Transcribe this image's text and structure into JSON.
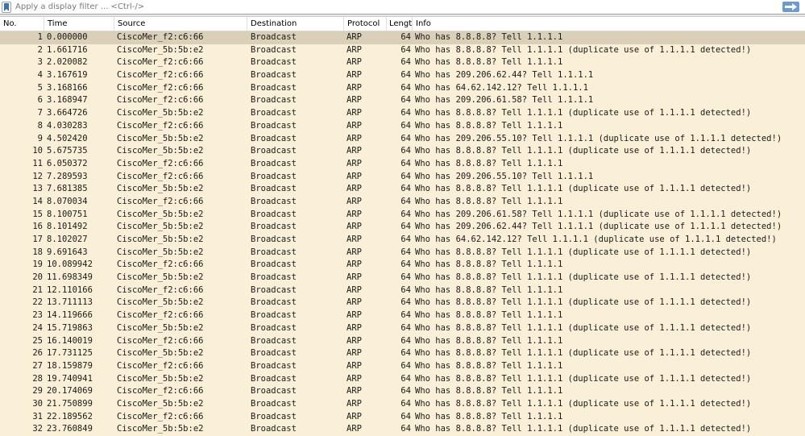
{
  "filter": {
    "placeholder": "Apply a display filter ... <Ctrl-/>",
    "value": "",
    "bookmark_icon": "bookmark-icon",
    "apply_icon": "arrow-right-icon",
    "apply_color": "#6c9bd1"
  },
  "columns": [
    "No.",
    "Time",
    "Source",
    "Destination",
    "Protocol",
    "Length",
    "Info"
  ],
  "colors": {
    "row_bg": "#faf0d7",
    "selected_bg": "#d9d0b7"
  },
  "selected_row": 1,
  "packets": [
    {
      "no": "1",
      "time": "0.000000",
      "source": "CiscoMer_f2:c6:66",
      "destination": "Broadcast",
      "protocol": "ARP",
      "length": "64",
      "info": "Who has 8.8.8.8? Tell 1.1.1.1"
    },
    {
      "no": "2",
      "time": "1.661716",
      "source": "CiscoMer_5b:5b:e2",
      "destination": "Broadcast",
      "protocol": "ARP",
      "length": "64",
      "info": "Who has 8.8.8.8? Tell 1.1.1.1 (duplicate use of 1.1.1.1 detected!)"
    },
    {
      "no": "3",
      "time": "2.020082",
      "source": "CiscoMer_f2:c6:66",
      "destination": "Broadcast",
      "protocol": "ARP",
      "length": "64",
      "info": "Who has 8.8.8.8? Tell 1.1.1.1"
    },
    {
      "no": "4",
      "time": "3.167619",
      "source": "CiscoMer_f2:c6:66",
      "destination": "Broadcast",
      "protocol": "ARP",
      "length": "64",
      "info": "Who has 209.206.62.44? Tell 1.1.1.1"
    },
    {
      "no": "5",
      "time": "3.168166",
      "source": "CiscoMer_f2:c6:66",
      "destination": "Broadcast",
      "protocol": "ARP",
      "length": "64",
      "info": "Who has 64.62.142.12? Tell 1.1.1.1"
    },
    {
      "no": "6",
      "time": "3.168947",
      "source": "CiscoMer_f2:c6:66",
      "destination": "Broadcast",
      "protocol": "ARP",
      "length": "64",
      "info": "Who has 209.206.61.58? Tell 1.1.1.1"
    },
    {
      "no": "7",
      "time": "3.664726",
      "source": "CiscoMer_5b:5b:e2",
      "destination": "Broadcast",
      "protocol": "ARP",
      "length": "64",
      "info": "Who has 8.8.8.8? Tell 1.1.1.1 (duplicate use of 1.1.1.1 detected!)"
    },
    {
      "no": "8",
      "time": "4.030283",
      "source": "CiscoMer_f2:c6:66",
      "destination": "Broadcast",
      "protocol": "ARP",
      "length": "64",
      "info": "Who has 8.8.8.8? Tell 1.1.1.1"
    },
    {
      "no": "9",
      "time": "4.502420",
      "source": "CiscoMer_5b:5b:e2",
      "destination": "Broadcast",
      "protocol": "ARP",
      "length": "64",
      "info": "Who has 209.206.55.10? Tell 1.1.1.1 (duplicate use of 1.1.1.1 detected!)"
    },
    {
      "no": "10",
      "time": "5.675735",
      "source": "CiscoMer_5b:5b:e2",
      "destination": "Broadcast",
      "protocol": "ARP",
      "length": "64",
      "info": "Who has 8.8.8.8? Tell 1.1.1.1 (duplicate use of 1.1.1.1 detected!)"
    },
    {
      "no": "11",
      "time": "6.050372",
      "source": "CiscoMer_f2:c6:66",
      "destination": "Broadcast",
      "protocol": "ARP",
      "length": "64",
      "info": "Who has 8.8.8.8? Tell 1.1.1.1"
    },
    {
      "no": "12",
      "time": "7.289593",
      "source": "CiscoMer_f2:c6:66",
      "destination": "Broadcast",
      "protocol": "ARP",
      "length": "64",
      "info": "Who has 209.206.55.10? Tell 1.1.1.1"
    },
    {
      "no": "13",
      "time": "7.681385",
      "source": "CiscoMer_5b:5b:e2",
      "destination": "Broadcast",
      "protocol": "ARP",
      "length": "64",
      "info": "Who has 8.8.8.8? Tell 1.1.1.1 (duplicate use of 1.1.1.1 detected!)"
    },
    {
      "no": "14",
      "time": "8.070034",
      "source": "CiscoMer_f2:c6:66",
      "destination": "Broadcast",
      "protocol": "ARP",
      "length": "64",
      "info": "Who has 8.8.8.8? Tell 1.1.1.1"
    },
    {
      "no": "15",
      "time": "8.100751",
      "source": "CiscoMer_5b:5b:e2",
      "destination": "Broadcast",
      "protocol": "ARP",
      "length": "64",
      "info": "Who has 209.206.61.58? Tell 1.1.1.1 (duplicate use of 1.1.1.1 detected!)"
    },
    {
      "no": "16",
      "time": "8.101492",
      "source": "CiscoMer_5b:5b:e2",
      "destination": "Broadcast",
      "protocol": "ARP",
      "length": "64",
      "info": "Who has 209.206.62.44? Tell 1.1.1.1 (duplicate use of 1.1.1.1 detected!)"
    },
    {
      "no": "17",
      "time": "8.102027",
      "source": "CiscoMer_5b:5b:e2",
      "destination": "Broadcast",
      "protocol": "ARP",
      "length": "64",
      "info": "Who has 64.62.142.12? Tell 1.1.1.1 (duplicate use of 1.1.1.1 detected!)"
    },
    {
      "no": "18",
      "time": "9.691643",
      "source": "CiscoMer_5b:5b:e2",
      "destination": "Broadcast",
      "protocol": "ARP",
      "length": "64",
      "info": "Who has 8.8.8.8? Tell 1.1.1.1 (duplicate use of 1.1.1.1 detected!)"
    },
    {
      "no": "19",
      "time": "10.089942",
      "source": "CiscoMer_f2:c6:66",
      "destination": "Broadcast",
      "protocol": "ARP",
      "length": "64",
      "info": "Who has 8.8.8.8? Tell 1.1.1.1"
    },
    {
      "no": "20",
      "time": "11.698349",
      "source": "CiscoMer_5b:5b:e2",
      "destination": "Broadcast",
      "protocol": "ARP",
      "length": "64",
      "info": "Who has 8.8.8.8? Tell 1.1.1.1 (duplicate use of 1.1.1.1 detected!)"
    },
    {
      "no": "21",
      "time": "12.110166",
      "source": "CiscoMer_f2:c6:66",
      "destination": "Broadcast",
      "protocol": "ARP",
      "length": "64",
      "info": "Who has 8.8.8.8? Tell 1.1.1.1"
    },
    {
      "no": "22",
      "time": "13.711113",
      "source": "CiscoMer_5b:5b:e2",
      "destination": "Broadcast",
      "protocol": "ARP",
      "length": "64",
      "info": "Who has 8.8.8.8? Tell 1.1.1.1 (duplicate use of 1.1.1.1 detected!)"
    },
    {
      "no": "23",
      "time": "14.119666",
      "source": "CiscoMer_f2:c6:66",
      "destination": "Broadcast",
      "protocol": "ARP",
      "length": "64",
      "info": "Who has 8.8.8.8? Tell 1.1.1.1"
    },
    {
      "no": "24",
      "time": "15.719863",
      "source": "CiscoMer_5b:5b:e2",
      "destination": "Broadcast",
      "protocol": "ARP",
      "length": "64",
      "info": "Who has 8.8.8.8? Tell 1.1.1.1 (duplicate use of 1.1.1.1 detected!)"
    },
    {
      "no": "25",
      "time": "16.140019",
      "source": "CiscoMer_f2:c6:66",
      "destination": "Broadcast",
      "protocol": "ARP",
      "length": "64",
      "info": "Who has 8.8.8.8? Tell 1.1.1.1"
    },
    {
      "no": "26",
      "time": "17.731125",
      "source": "CiscoMer_5b:5b:e2",
      "destination": "Broadcast",
      "protocol": "ARP",
      "length": "64",
      "info": "Who has 8.8.8.8? Tell 1.1.1.1 (duplicate use of 1.1.1.1 detected!)"
    },
    {
      "no": "27",
      "time": "18.159879",
      "source": "CiscoMer_f2:c6:66",
      "destination": "Broadcast",
      "protocol": "ARP",
      "length": "64",
      "info": "Who has 8.8.8.8? Tell 1.1.1.1"
    },
    {
      "no": "28",
      "time": "19.740941",
      "source": "CiscoMer_5b:5b:e2",
      "destination": "Broadcast",
      "protocol": "ARP",
      "length": "64",
      "info": "Who has 8.8.8.8? Tell 1.1.1.1 (duplicate use of 1.1.1.1 detected!)"
    },
    {
      "no": "29",
      "time": "20.174069",
      "source": "CiscoMer_f2:c6:66",
      "destination": "Broadcast",
      "protocol": "ARP",
      "length": "64",
      "info": "Who has 8.8.8.8? Tell 1.1.1.1"
    },
    {
      "no": "30",
      "time": "21.750899",
      "source": "CiscoMer_5b:5b:e2",
      "destination": "Broadcast",
      "protocol": "ARP",
      "length": "64",
      "info": "Who has 8.8.8.8? Tell 1.1.1.1 (duplicate use of 1.1.1.1 detected!)"
    },
    {
      "no": "31",
      "time": "22.189562",
      "source": "CiscoMer_f2:c6:66",
      "destination": "Broadcast",
      "protocol": "ARP",
      "length": "64",
      "info": "Who has 8.8.8.8? Tell 1.1.1.1"
    },
    {
      "no": "32",
      "time": "23.760849",
      "source": "CiscoMer_5b:5b:e2",
      "destination": "Broadcast",
      "protocol": "ARP",
      "length": "64",
      "info": "Who has 8.8.8.8? Tell 1.1.1.1 (duplicate use of 1.1.1.1 detected!)"
    }
  ]
}
